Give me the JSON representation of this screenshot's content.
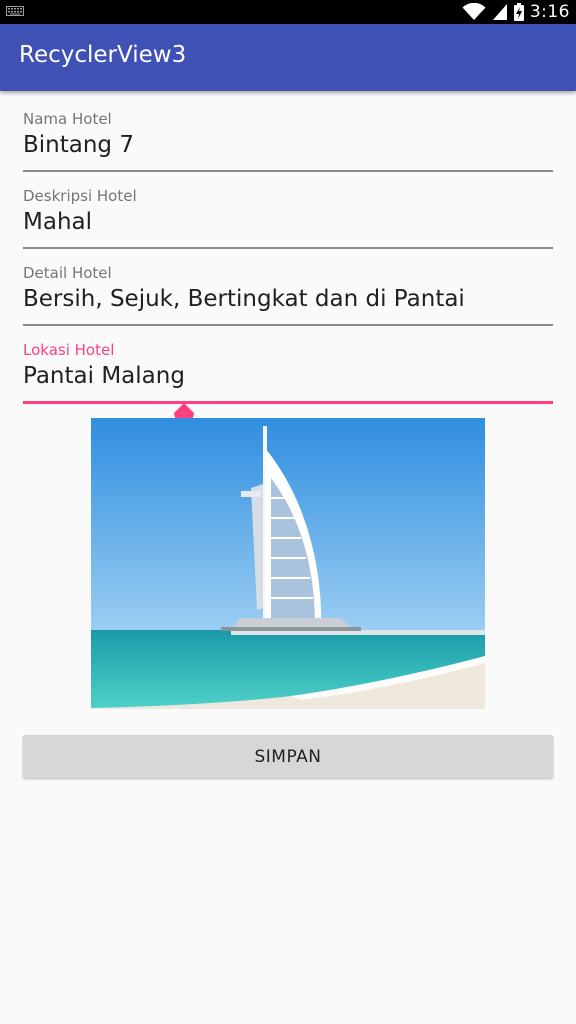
{
  "status_bar": {
    "time": "3:16",
    "icons": [
      "keyboard-icon",
      "wifi-icon",
      "cellular-signal-icon",
      "battery-charging-icon"
    ]
  },
  "app_bar": {
    "title": "RecyclerView3"
  },
  "form": {
    "fields": [
      {
        "label": "Nama Hotel",
        "value": "Bintang 7"
      },
      {
        "label": "Deskripsi Hotel",
        "value": "Mahal"
      },
      {
        "label": "Detail Hotel",
        "value": "Bersih, Sejuk, Bertingkat dan di Pantai"
      },
      {
        "label": "Lokasi Hotel",
        "value": "Pantai Malang"
      }
    ],
    "focused_field": 3
  },
  "colors": {
    "primary": "#3f51b5",
    "accent": "#ff4081",
    "background": "#fafafa",
    "button": "#d6d7d7"
  },
  "button": {
    "save_label": "SIMPAN"
  }
}
